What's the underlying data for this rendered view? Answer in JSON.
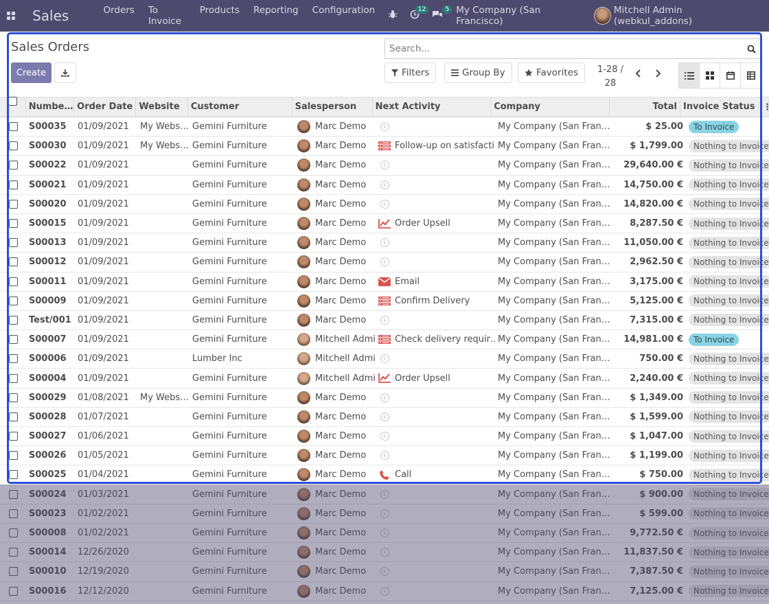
{
  "navbar": {
    "app_name": "Sales",
    "menu": [
      "Orders",
      "To Invoice",
      "Products",
      "Reporting",
      "Configuration"
    ],
    "activity_count": "12",
    "messages_count": "5",
    "company": "My Company (San Francisco)",
    "user": "Mitchell Admin (webkul_addons)"
  },
  "control_panel": {
    "title": "Sales Orders",
    "create_label": "Create",
    "search_placeholder": "Search...",
    "filters_label": "Filters",
    "group_by_label": "Group By",
    "favorites_label": "Favorites",
    "pager_range": "1-28 /",
    "pager_total": "28"
  },
  "table": {
    "columns": [
      "Numbe…",
      "Order Date",
      "Website",
      "Customer",
      "Salesperson",
      "Next Activity",
      "Company",
      "Total",
      "Invoice Status"
    ],
    "rows": [
      {
        "number": "S00035",
        "date": "01/09/2021",
        "website": "My Website",
        "customer": "Gemini Furniture",
        "salesperson": "Marc Demo",
        "avatar": "marc",
        "activity_icon": "clock",
        "activity": "",
        "company": "My Company (San Francis…",
        "total": "$ 25.00",
        "status": "To Invoice",
        "status_type": "info"
      },
      {
        "number": "S00030",
        "date": "01/09/2021",
        "website": "My Website",
        "customer": "Gemini Furniture",
        "salesperson": "Marc Demo",
        "avatar": "marc",
        "activity_icon": "tasks",
        "activity": "Follow-up on satisfacti…",
        "company": "My Company (San Francis…",
        "total": "$ 1,799.00",
        "status": "Nothing to Invoice",
        "status_type": "muted"
      },
      {
        "number": "S00022",
        "date": "01/09/2021",
        "website": "",
        "customer": "Gemini Furniture",
        "salesperson": "Marc Demo",
        "avatar": "marc",
        "activity_icon": "clock",
        "activity": "",
        "company": "My Company (San Francis…",
        "total": "29,640.00 €",
        "status": "Nothing to Invoice",
        "status_type": "muted"
      },
      {
        "number": "S00021",
        "date": "01/09/2021",
        "website": "",
        "customer": "Gemini Furniture",
        "salesperson": "Marc Demo",
        "avatar": "marc",
        "activity_icon": "clock",
        "activity": "",
        "company": "My Company (San Francis…",
        "total": "14,750.00 €",
        "status": "Nothing to Invoice",
        "status_type": "muted"
      },
      {
        "number": "S00020",
        "date": "01/09/2021",
        "website": "",
        "customer": "Gemini Furniture",
        "salesperson": "Marc Demo",
        "avatar": "marc",
        "activity_icon": "clock",
        "activity": "",
        "company": "My Company (San Francis…",
        "total": "14,820.00 €",
        "status": "Nothing to Invoice",
        "status_type": "muted"
      },
      {
        "number": "S00015",
        "date": "01/09/2021",
        "website": "",
        "customer": "Gemini Furniture",
        "salesperson": "Marc Demo",
        "avatar": "marc",
        "activity_icon": "chart",
        "activity": "Order Upsell",
        "company": "My Company (San Francis…",
        "total": "8,287.50 €",
        "status": "Nothing to Invoice",
        "status_type": "muted"
      },
      {
        "number": "S00013",
        "date": "01/09/2021",
        "website": "",
        "customer": "Gemini Furniture",
        "salesperson": "Marc Demo",
        "avatar": "marc",
        "activity_icon": "clock",
        "activity": "",
        "company": "My Company (San Francis…",
        "total": "11,050.00 €",
        "status": "Nothing to Invoice",
        "status_type": "muted"
      },
      {
        "number": "S00012",
        "date": "01/09/2021",
        "website": "",
        "customer": "Gemini Furniture",
        "salesperson": "Marc Demo",
        "avatar": "marc",
        "activity_icon": "clock",
        "activity": "",
        "company": "My Company (San Francis…",
        "total": "2,962.50 €",
        "status": "Nothing to Invoice",
        "status_type": "muted"
      },
      {
        "number": "S00011",
        "date": "01/09/2021",
        "website": "",
        "customer": "Gemini Furniture",
        "salesperson": "Marc Demo",
        "avatar": "marc",
        "activity_icon": "envelope",
        "activity": "Email",
        "company": "My Company (San Francis…",
        "total": "3,175.00 €",
        "status": "Nothing to Invoice",
        "status_type": "muted"
      },
      {
        "number": "S00009",
        "date": "01/09/2021",
        "website": "",
        "customer": "Gemini Furniture",
        "salesperson": "Marc Demo",
        "avatar": "marc",
        "activity_icon": "tasks",
        "activity": "Confirm Delivery",
        "company": "My Company (San Francis…",
        "total": "5,125.00 €",
        "status": "Nothing to Invoice",
        "status_type": "muted"
      },
      {
        "number": "Test/001",
        "date": "01/09/2021",
        "website": "",
        "customer": "Gemini Furniture",
        "salesperson": "Marc Demo",
        "avatar": "marc",
        "activity_icon": "clock",
        "activity": "",
        "company": "My Company (San Francis…",
        "total": "7,315.00 €",
        "status": "Nothing to Invoice",
        "status_type": "muted"
      },
      {
        "number": "S00007",
        "date": "01/09/2021",
        "website": "",
        "customer": "Gemini Furniture",
        "salesperson": "Mitchell Admin",
        "avatar": "mitch",
        "activity_icon": "tasks",
        "activity": "Check delivery requir…",
        "company": "My Company (San Francis…",
        "total": "14,981.00 €",
        "status": "To Invoice",
        "status_type": "info"
      },
      {
        "number": "S00006",
        "date": "01/09/2021",
        "website": "",
        "customer": "Lumber Inc",
        "salesperson": "Mitchell Admin",
        "avatar": "mitch",
        "activity_icon": "clock",
        "activity": "",
        "company": "My Company (San Francis…",
        "total": "750.00 €",
        "status": "Nothing to Invoice",
        "status_type": "muted"
      },
      {
        "number": "S00004",
        "date": "01/09/2021",
        "website": "",
        "customer": "Gemini Furniture",
        "salesperson": "Mitchell Admin",
        "avatar": "mitch",
        "activity_icon": "chart",
        "activity": "Order Upsell",
        "company": "My Company (San Francis…",
        "total": "2,240.00 €",
        "status": "Nothing to Invoice",
        "status_type": "muted"
      },
      {
        "number": "S00029",
        "date": "01/08/2021",
        "website": "My Website",
        "customer": "Gemini Furniture",
        "salesperson": "Marc Demo",
        "avatar": "marc",
        "activity_icon": "clock",
        "activity": "",
        "company": "My Company (San Francis…",
        "total": "$ 1,349.00",
        "status": "Nothing to Invoice",
        "status_type": "muted"
      },
      {
        "number": "S00028",
        "date": "01/07/2021",
        "website": "",
        "customer": "Gemini Furniture",
        "salesperson": "Marc Demo",
        "avatar": "marc",
        "activity_icon": "clock",
        "activity": "",
        "company": "My Company (San Francis…",
        "total": "$ 1,599.00",
        "status": "Nothing to Invoice",
        "status_type": "muted"
      },
      {
        "number": "S00027",
        "date": "01/06/2021",
        "website": "",
        "customer": "Gemini Furniture",
        "salesperson": "Marc Demo",
        "avatar": "marc",
        "activity_icon": "clock",
        "activity": "",
        "company": "My Company (San Francis…",
        "total": "$ 1,047.00",
        "status": "Nothing to Invoice",
        "status_type": "muted"
      },
      {
        "number": "S00026",
        "date": "01/05/2021",
        "website": "",
        "customer": "Gemini Furniture",
        "salesperson": "Marc Demo",
        "avatar": "marc",
        "activity_icon": "clock",
        "activity": "",
        "company": "My Company (San Francis…",
        "total": "$ 1,199.00",
        "status": "Nothing to Invoice",
        "status_type": "muted"
      },
      {
        "number": "S00025",
        "date": "01/04/2021",
        "website": "",
        "customer": "Gemini Furniture",
        "salesperson": "Marc Demo",
        "avatar": "marc",
        "activity_icon": "phone",
        "activity": "Call",
        "company": "My Company (San Francis…",
        "total": "$ 750.00",
        "status": "Nothing to Invoice",
        "status_type": "muted"
      },
      {
        "number": "S00024",
        "date": "01/03/2021",
        "website": "",
        "customer": "Gemini Furniture",
        "salesperson": "Marc Demo",
        "avatar": "marc",
        "activity_icon": "clock",
        "activity": "",
        "company": "My Company (San Francis…",
        "total": "$ 900.00",
        "status": "Nothing to Invoice",
        "status_type": "muted"
      },
      {
        "number": "S00023",
        "date": "01/02/2021",
        "website": "",
        "customer": "Gemini Furniture",
        "salesperson": "Marc Demo",
        "avatar": "marc",
        "activity_icon": "clock",
        "activity": "",
        "company": "My Company (San Francis…",
        "total": "$ 599.00",
        "status": "Nothing to Invoice",
        "status_type": "muted"
      },
      {
        "number": "S00008",
        "date": "01/02/2021",
        "website": "",
        "customer": "Gemini Furniture",
        "salesperson": "Marc Demo",
        "avatar": "marc",
        "activity_icon": "clock",
        "activity": "",
        "company": "My Company (San Francis…",
        "total": "9,772.50 €",
        "status": "Nothing to Invoice",
        "status_type": "muted"
      },
      {
        "number": "S00014",
        "date": "12/26/2020",
        "website": "",
        "customer": "Gemini Furniture",
        "salesperson": "Marc Demo",
        "avatar": "marc",
        "activity_icon": "clock",
        "activity": "",
        "company": "My Company (San Francis…",
        "total": "11,837.50 €",
        "status": "Nothing to Invoice",
        "status_type": "muted"
      },
      {
        "number": "S00010",
        "date": "12/19/2020",
        "website": "",
        "customer": "Gemini Furniture",
        "salesperson": "Marc Demo",
        "avatar": "marc",
        "activity_icon": "clock",
        "activity": "",
        "company": "My Company (San Francis…",
        "total": "7,387.50 €",
        "status": "Nothing to Invoice",
        "status_type": "muted"
      },
      {
        "number": "S00016",
        "date": "12/12/2020",
        "website": "",
        "customer": "Gemini Furniture",
        "salesperson": "Marc Demo",
        "avatar": "marc",
        "activity_icon": "clock",
        "activity": "",
        "company": "My Company (San Francis…",
        "total": "7,125.00 €",
        "status": "Nothing to Invoice",
        "status_type": "muted"
      }
    ]
  },
  "colors": {
    "navbar": "#4e4a6e",
    "primary": "#7c7bad",
    "activity_red": "#d9534f",
    "focus_frame": "#2c4fd6"
  }
}
